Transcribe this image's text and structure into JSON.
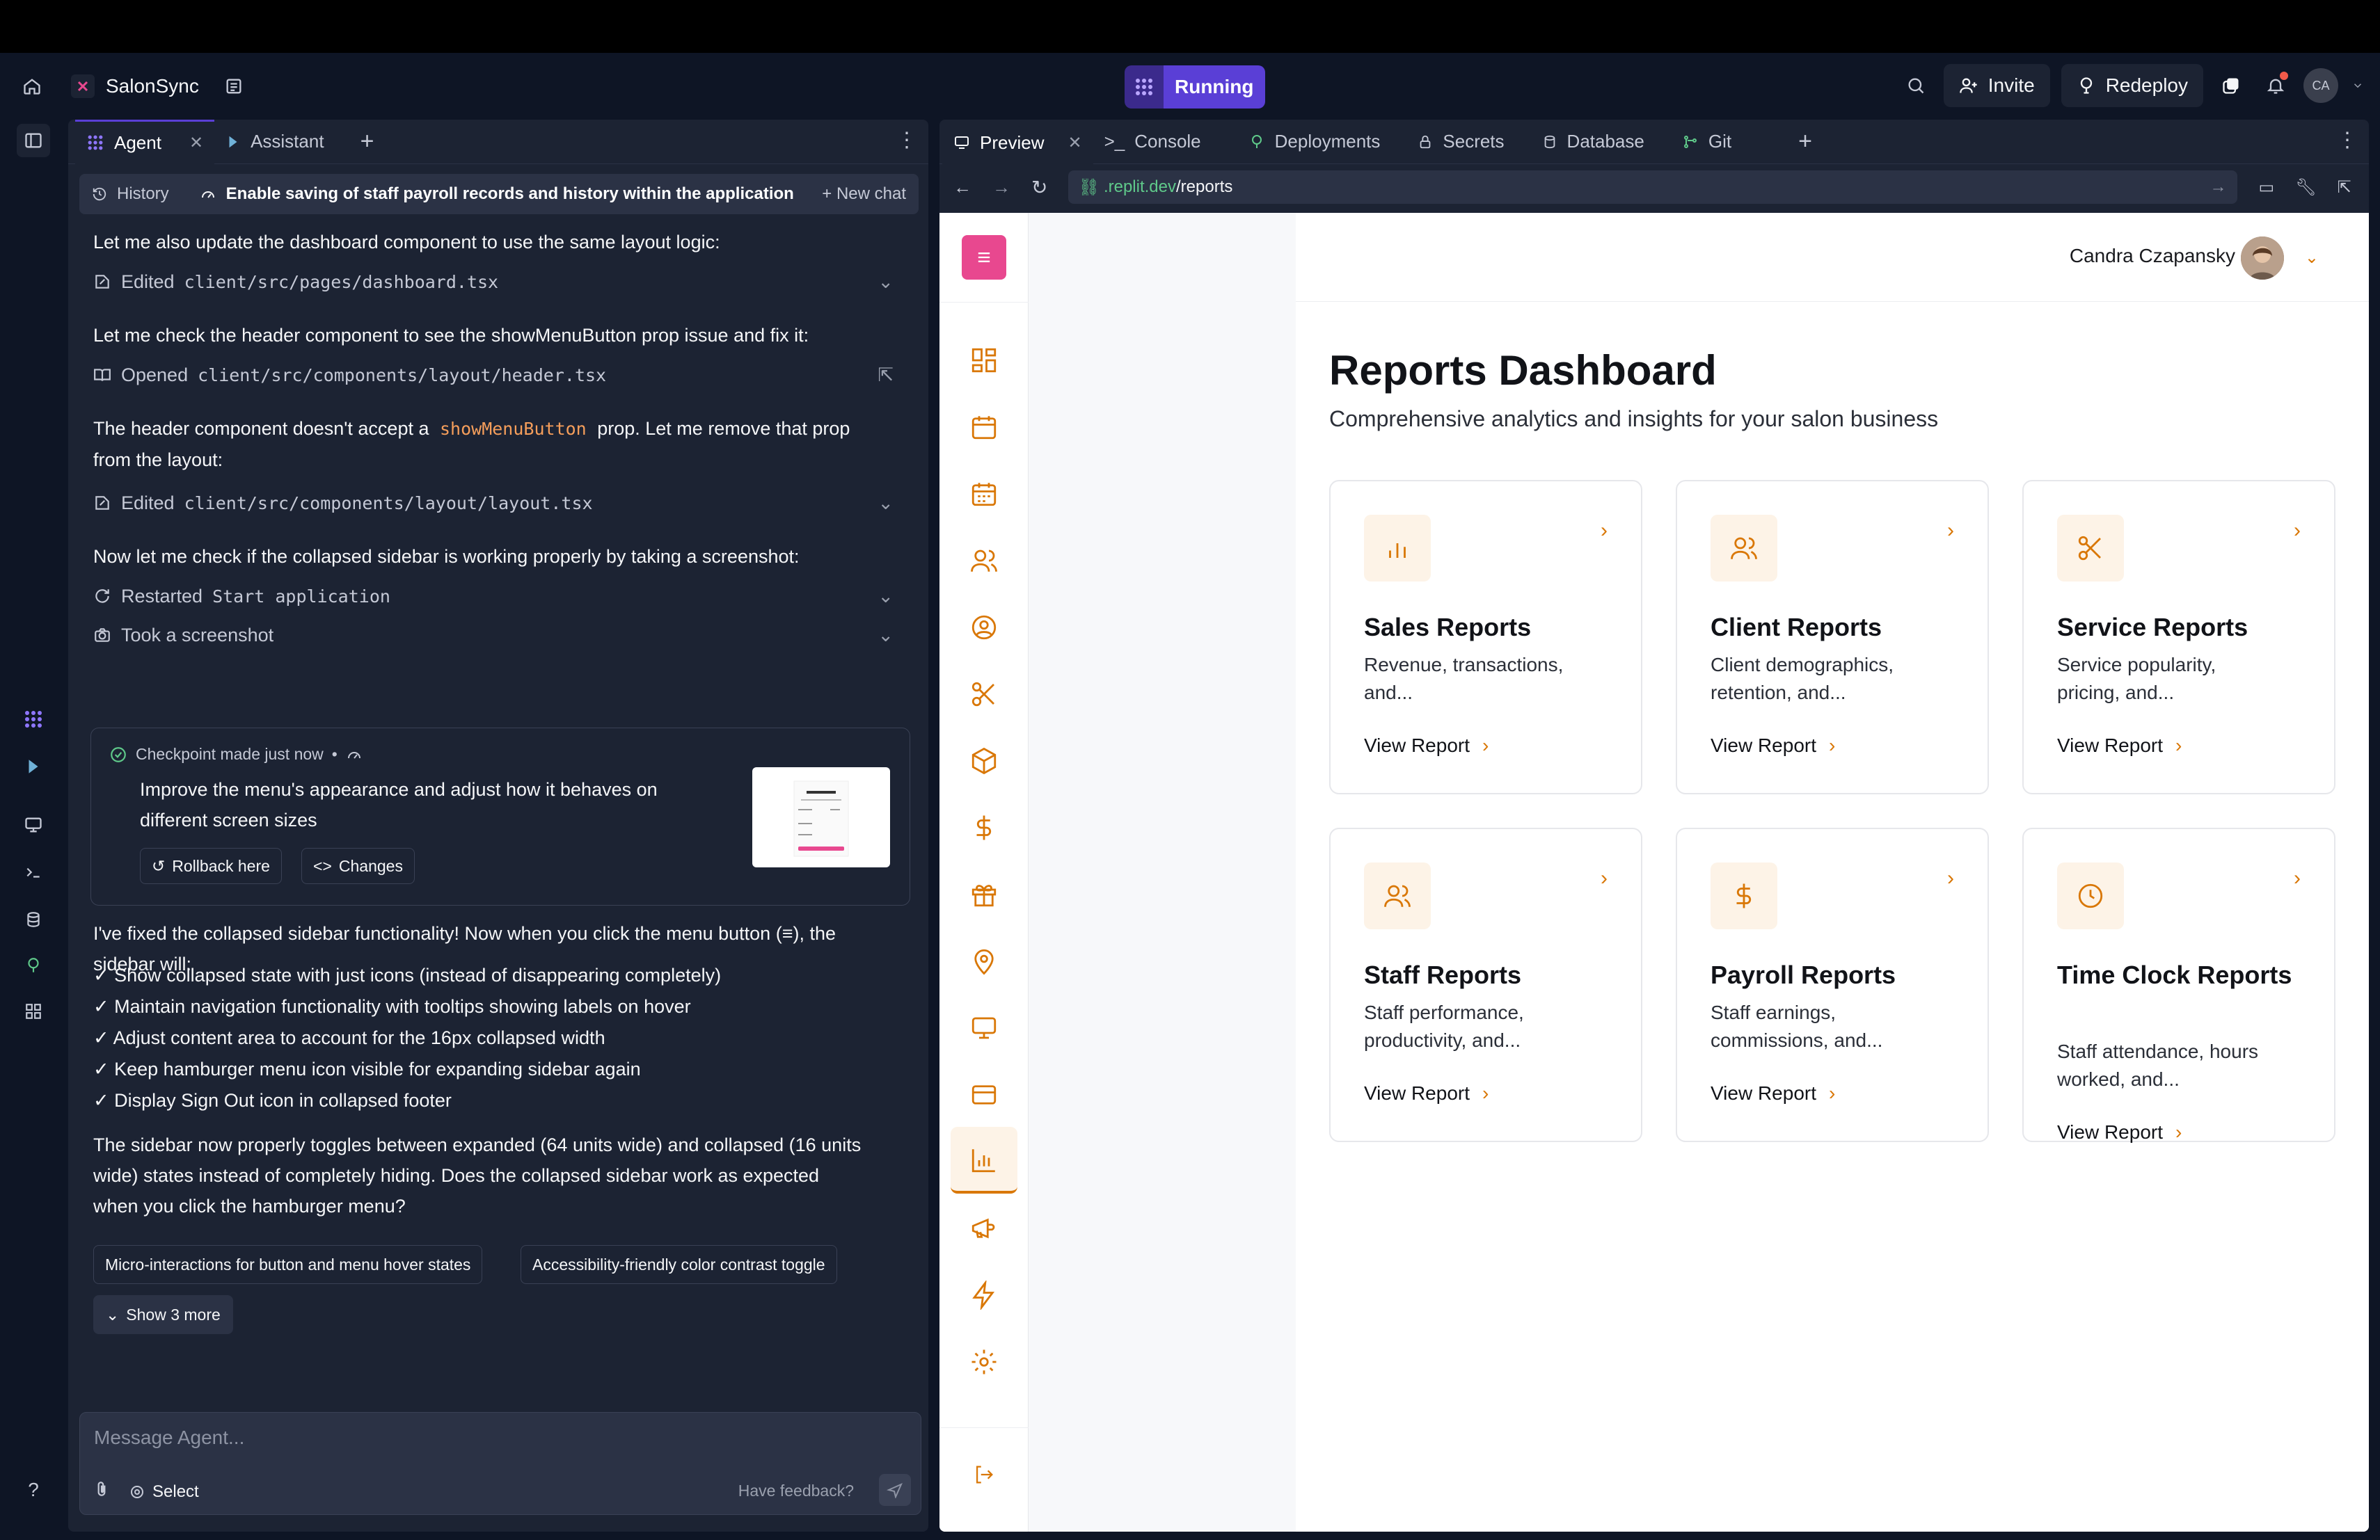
{
  "app": {
    "name": "SalonSync",
    "status": "Running"
  },
  "header_actions": {
    "invite": "Invite",
    "redeploy": "Redeploy",
    "avatar_initials": "CA"
  },
  "agent_panel": {
    "tabs": [
      {
        "label": "Agent"
      },
      {
        "label": "Assistant"
      }
    ],
    "history_label": "History",
    "chat_title": "Enable saving of staff payroll records and history within the application",
    "new_chat": "New chat",
    "messages": {
      "m1": "Let me also update the dashboard component to use the same layout logic:",
      "a1_verb": "Edited",
      "a1_path": "client/src/pages/dashboard.tsx",
      "m2": "Let me check the header component to see the showMenuButton prop issue and fix it:",
      "a2_verb": "Opened",
      "a2_path": "client/src/components/layout/header.tsx",
      "m3_pre": "The header component doesn't accept a",
      "m3_code": "showMenuButton",
      "m3_post": "prop. Let me remove that prop",
      "m3_line2": "from the layout:",
      "a3_verb": "Edited",
      "a3_path": "client/src/components/layout/layout.tsx",
      "m4": "Now let me check if the collapsed sidebar is working properly by taking a screenshot:",
      "a4_verb": "Restarted",
      "a4_path": "Start application",
      "a5": "Took a screenshot"
    },
    "checkpoint": {
      "head": "Checkpoint made just now",
      "dot": "•",
      "desc": "Improve the menu's appearance and adjust how it behaves on different screen sizes",
      "rollback": "Rollback here",
      "changes": "Changes"
    },
    "summary_line1": "I've fixed the collapsed sidebar functionality! Now when you click the menu button (≡), the",
    "summary_line2": "sidebar will:",
    "checks": [
      "✓ Show collapsed state with just icons (instead of disappearing completely)",
      "✓ Maintain navigation functionality with tooltips showing labels on hover",
      "✓ Adjust content area to account for the 16px collapsed width",
      "✓ Keep hamburger menu icon visible for expanding sidebar again",
      "✓ Display Sign Out icon in collapsed footer"
    ],
    "closing": [
      "The sidebar now properly toggles between expanded (64 units wide) and collapsed (16 units",
      "wide) states instead of completely hiding. Does the collapsed sidebar work as expected",
      "when you click the hamburger menu?"
    ],
    "suggestions": [
      "Micro-interactions for button and menu hover states",
      "Accessibility-friendly color contrast toggle"
    ],
    "show_more": "Show 3 more",
    "composer": {
      "placeholder": "Message Agent...",
      "select": "Select",
      "feedback": "Have feedback?"
    }
  },
  "preview_panel": {
    "tabs": [
      {
        "label": "Preview"
      },
      {
        "label": "Console"
      },
      {
        "label": "Deployments"
      },
      {
        "label": "Secrets"
      },
      {
        "label": "Database"
      },
      {
        "label": "Git"
      }
    ],
    "url_host": ".replit.dev",
    "url_path": "/reports"
  },
  "site": {
    "user_name": "Candra Czapansky",
    "title": "Reports Dashboard",
    "subtitle": "Comprehensive analytics and insights for your salon business",
    "view_report": "View Report",
    "cards": [
      {
        "title": "Sales Reports",
        "desc": "Revenue, transactions, and...",
        "icon": "bar-chart-icon"
      },
      {
        "title": "Client Reports",
        "desc": "Client demographics, retention, and...",
        "icon": "users-icon"
      },
      {
        "title": "Service Reports",
        "desc": "Service popularity, pricing, and...",
        "icon": "scissors-icon"
      },
      {
        "title": "Staff Reports",
        "desc": "Staff performance, productivity, and...",
        "icon": "users-icon"
      },
      {
        "title": "Payroll Reports",
        "desc": "Staff earnings, commissions, and...",
        "icon": "dollar-icon"
      },
      {
        "title": "Time Clock Reports",
        "desc": "Staff attendance, hours worked, and...",
        "icon": "clock-icon"
      }
    ],
    "accent": "#d97706",
    "brand_pink": "#e8488f"
  }
}
